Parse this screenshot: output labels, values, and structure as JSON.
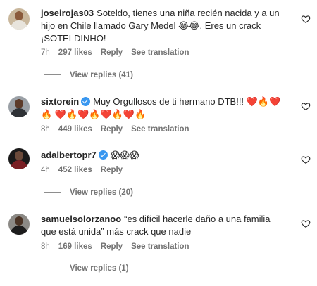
{
  "comments": [
    {
      "username": "joseirojas03",
      "verified": false,
      "text": "Soteldo, tienes una niña recién nacida y a un hijo en Chile llamado Gary Medel 😂😂. Eres un crack ¡SOTELDINHO!",
      "age": "7h",
      "likes": "297 likes",
      "reply_label": "Reply",
      "translate_label": "See translation",
      "view_replies": "View replies (41)",
      "avatar_colors": {
        "bg": "#c9b79c",
        "skin": "#8a5a3b",
        "shirt": "#e8e4dc"
      }
    },
    {
      "username": "sixtorein",
      "verified": true,
      "text": "Muy Orgullosos de ti hermano DTB!!! ❤️🔥❤️🔥 ❤️🔥❤️🔥❤️🔥❤️🔥",
      "age": "8h",
      "likes": "449 likes",
      "reply_label": "Reply",
      "translate_label": "See translation",
      "view_replies": "",
      "avatar_colors": {
        "bg": "#9aa0a6",
        "skin": "#5c3b2a",
        "shirt": "#2f3236"
      }
    },
    {
      "username": "adalbertopr7",
      "verified": true,
      "text": "😱😱😱",
      "age": "4h",
      "likes": "452 likes",
      "reply_label": "Reply",
      "translate_label": "",
      "view_replies": "View replies (20)",
      "avatar_colors": {
        "bg": "#1a1a1a",
        "skin": "#6b4a3a",
        "shirt": "#7a1f24"
      }
    },
    {
      "username": "samuelsolorzanoo",
      "verified": false,
      "text": "“es difícil hacerle daño a una familia que está unida” más crack que nadie",
      "age": "8h",
      "likes": "169 likes",
      "reply_label": "Reply",
      "translate_label": "See translation",
      "view_replies": "View replies (1)",
      "avatar_colors": {
        "bg": "#8c8a86",
        "skin": "#4b3426",
        "shirt": "#1c1c1c"
      }
    }
  ],
  "icons": {
    "like": "heart-outline-icon",
    "verified": "verified-badge-icon"
  },
  "colors": {
    "text": "#262626",
    "muted": "#737373",
    "verified": "#3897f0"
  }
}
